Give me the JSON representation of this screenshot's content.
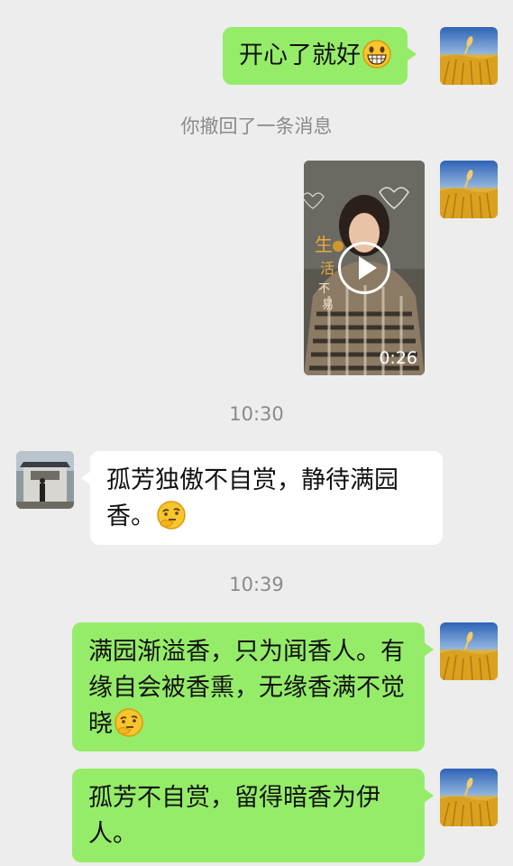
{
  "messages": {
    "m1_text": "开心了就好",
    "recall_notice": "你撤回了一条消息",
    "video_duration": "0:26",
    "time1": "10:30",
    "m2_text": "孤芳独傲不自赏，静待满园香。",
    "time2": "10:39",
    "m3_text": "满园渐溢香，只为闻香人。有缘自会被香熏，无缘香满不觉晓",
    "m4_text": "孤芳不自赏，留得暗香为伊人。"
  },
  "icons": {
    "grin": "grinning-emoji-icon",
    "think": "thinking-emoji-icon",
    "play": "play-icon"
  },
  "colors": {
    "background": "#ededed",
    "sent_bubble": "#95ec69",
    "received_bubble": "#ffffff",
    "meta_text": "#8a8a8a"
  }
}
